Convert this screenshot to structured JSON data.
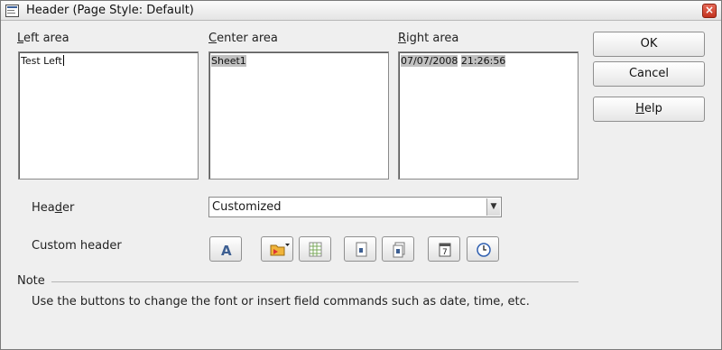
{
  "window": {
    "title": "Header (Page Style: Default)",
    "close_glyph": "×"
  },
  "areas": {
    "left": {
      "label": "Left area",
      "content": "Test Left"
    },
    "center": {
      "label": "Center area",
      "field_sheet": "Sheet1"
    },
    "right": {
      "label": "Right area",
      "field_date": "07/07/2008",
      "field_time": "21:26:56"
    }
  },
  "buttons": {
    "ok": "OK",
    "cancel": "Cancel",
    "help": "Help"
  },
  "header": {
    "label": "Header",
    "value": "Customized"
  },
  "custom_header": {
    "label": "Custom header",
    "tools": [
      {
        "name": "text-attributes-icon"
      },
      {
        "name": "file-name-icon"
      },
      {
        "name": "sheet-name-icon"
      },
      {
        "name": "page-icon"
      },
      {
        "name": "pages-icon"
      },
      {
        "name": "date-icon"
      },
      {
        "name": "time-icon"
      }
    ]
  },
  "note": {
    "label": "Note",
    "text": "Use the buttons to change the font or insert field commands such as date, time, etc."
  },
  "colors": {
    "accent_close": "#c2321f",
    "field_highlight": "#c0c0c0"
  }
}
